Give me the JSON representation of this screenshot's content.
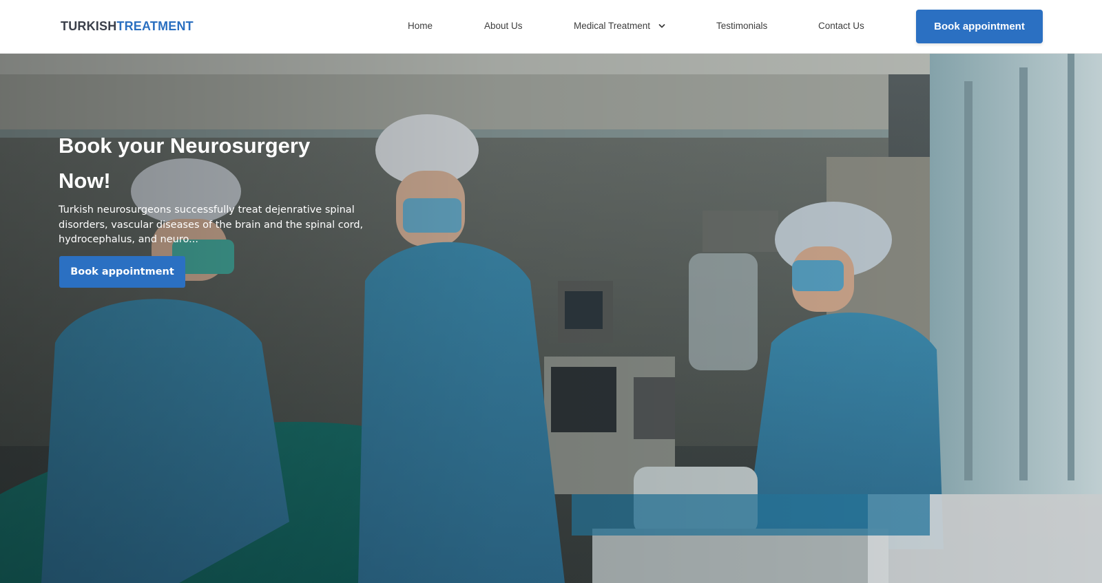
{
  "brand": {
    "part1": "TURKISH",
    "part2": "TREATMENT",
    "color_dark": "#3a3f4a",
    "color_accent": "#2a6fc0"
  },
  "nav": {
    "items": [
      {
        "id": "home",
        "label": "Home"
      },
      {
        "id": "about",
        "label": "About Us"
      },
      {
        "id": "medical",
        "label": "Medical Treatment",
        "has_dropdown": true
      },
      {
        "id": "testimonials",
        "label": "Testimonials"
      },
      {
        "id": "contact",
        "label": "Contact Us"
      }
    ],
    "cta_label": "Book appointment"
  },
  "hero": {
    "title": "Book your Neurosurgery Now!",
    "description": "Turkish neurosurgeons successfully treat dejenrative spinal disorders, vascular diseases of the brain and the spinal cord, hydrocephalus, and neuro...",
    "cta_label": "Book appointment"
  },
  "colors": {
    "primary": "#2b70c2",
    "header_bg": "#ffffff",
    "nav_text": "#3d3d3d"
  },
  "icons": {
    "dropdown": "chevron-down-icon"
  }
}
